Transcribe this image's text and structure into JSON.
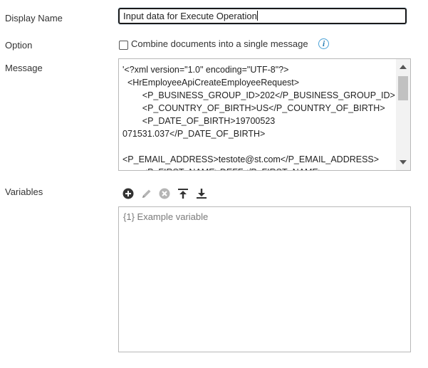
{
  "display_name": {
    "label": "Display Name",
    "value": "Input data for Execute Operation"
  },
  "option": {
    "label": "Option",
    "checkbox_label": "Combine documents into a single message",
    "checked": false,
    "info_icon": "info-icon"
  },
  "message": {
    "label": "Message",
    "lines": [
      "'<?xml version=\"1.0\" encoding=\"UTF-8\"?>",
      "  <HrEmployeeApiCreateEmployeeRequest>",
      "        <P_BUSINESS_GROUP_ID>202</P_BUSINESS_GROUP_ID>",
      "        <P_COUNTRY_OF_BIRTH>US</P_COUNTRY_OF_BIRTH>",
      "        <P_DATE_OF_BIRTH>19700523",
      "071531.037</P_DATE_OF_BIRTH>",
      "",
      "<P_EMAIL_ADDRESS>testote@st.com</P_EMAIL_ADDRESS>",
      "        <P_FIRST_NAME>DEFF</P_FIRST_NAME>"
    ]
  },
  "variables": {
    "label": "Variables",
    "placeholder": "{1} Example variable",
    "toolbar": [
      "add-icon",
      "edit-icon",
      "remove-icon",
      "move-top-icon",
      "move-bottom-icon"
    ]
  },
  "colors": {
    "dark_icon": "#333333",
    "disabled_icon": "#b0b0b0",
    "info_accent": "#4aa1d6"
  }
}
